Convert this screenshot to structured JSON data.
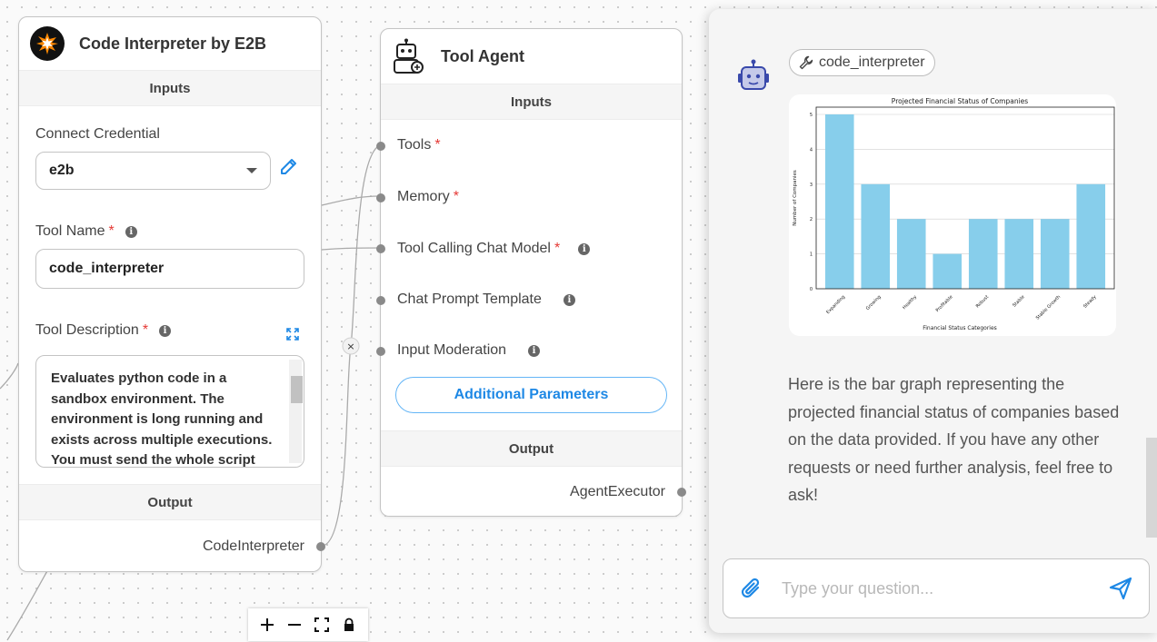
{
  "code_node": {
    "title": "Code Interpreter by E2B",
    "inputs_label": "Inputs",
    "credential_label": "Connect Credential",
    "credential_value": "e2b",
    "tool_name_label": "Tool Name",
    "tool_name_value": "code_interpreter",
    "tool_desc_label": "Tool Description",
    "tool_desc_value": "Evaluates python code in a sandbox environment. The environment is long running and exists across multiple executions. You must send the whole script",
    "output_label": "Output",
    "output_name": "CodeInterpreter"
  },
  "agent_node": {
    "title": "Tool Agent",
    "inputs_label": "Inputs",
    "inputs": [
      {
        "label": "Tools",
        "required": "*"
      },
      {
        "label": "Memory",
        "required": "*"
      },
      {
        "label": "Tool Calling Chat Model",
        "required": "*"
      },
      {
        "label": "Chat Prompt Template",
        "required": ""
      },
      {
        "label": "Input Moderation",
        "required": ""
      }
    ],
    "additional_params_label": "Additional Parameters",
    "output_label": "Output",
    "output_name": "AgentExecutor"
  },
  "edge_delete_symbol": "×",
  "chat": {
    "tool_chip_label": "code_interpreter",
    "message": "Here is the bar graph representing the projected financial status of companies based on the data provided. If you have any other requests or need further analysis, feel free to ask!",
    "input_placeholder": "Type your question..."
  },
  "chart_data": {
    "type": "bar",
    "title": "Projected Financial Status of Companies",
    "xlabel": "Financial Status Categories",
    "ylabel": "Number of Companies",
    "categories": [
      "Expanding",
      "Growing",
      "Healthy",
      "Profitable",
      "Robust",
      "Stable",
      "Stable Growth",
      "Steady"
    ],
    "values": [
      5,
      3,
      2,
      1,
      2,
      2,
      2,
      3
    ],
    "ylim": [
      0,
      5
    ],
    "yticks": [
      0,
      1,
      2,
      3,
      4,
      5
    ],
    "grid": "horizontal",
    "bar_color": "#87ceeb"
  },
  "colors": {
    "accent": "#1e88e5",
    "required": "#e53935"
  }
}
